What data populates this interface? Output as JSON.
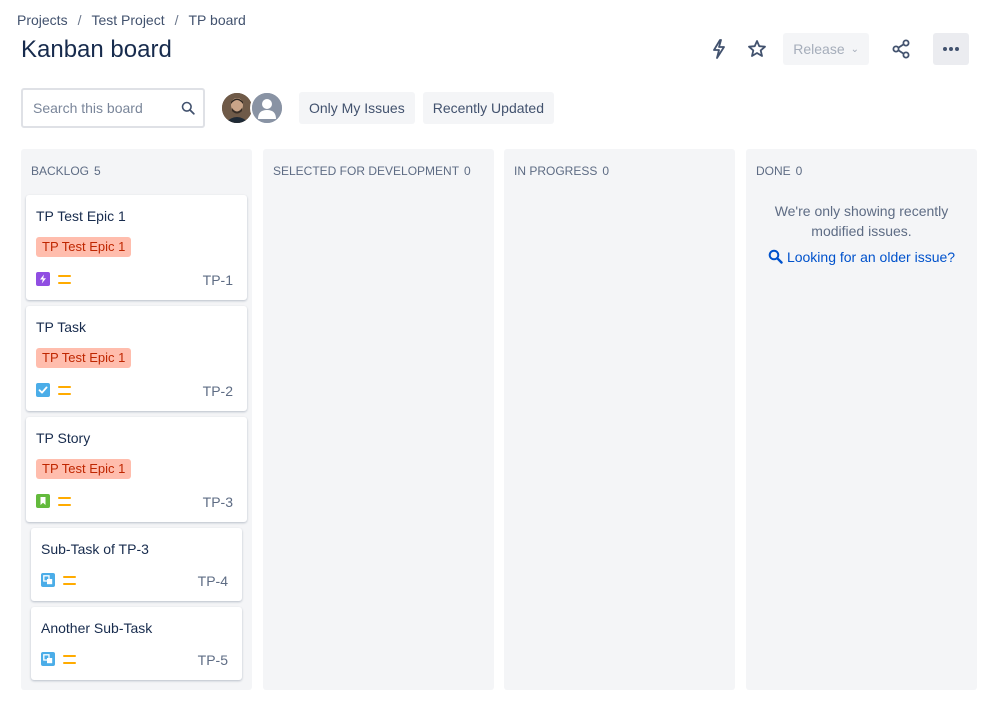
{
  "breadcrumb": [
    "Projects",
    "Test Project",
    "TP board"
  ],
  "breadcrumb_sep": "/",
  "title": "Kanban board",
  "header": {
    "actions": [
      "lightning-icon",
      "star-icon",
      "release",
      "share-icon",
      "more-icon"
    ],
    "release_label": "Release"
  },
  "search": {
    "placeholder": "Search this board"
  },
  "filters": {
    "only_my_issues": "Only My Issues",
    "recently_updated": "Recently Updated"
  },
  "columns": [
    {
      "name": "BACKLOG",
      "count": "5"
    },
    {
      "name": "SELECTED FOR DEVELOPMENT",
      "count": "0"
    },
    {
      "name": "IN PROGRESS",
      "count": "0"
    },
    {
      "name": "DONE",
      "count": "0"
    }
  ],
  "cards": [
    {
      "summary": "TP Test Epic 1",
      "epic": "TP Test Epic 1",
      "type": "epic",
      "priority": "medium",
      "key": "TP-1"
    },
    {
      "summary": "TP Task",
      "epic": "TP Test Epic 1",
      "type": "task",
      "priority": "medium",
      "key": "TP-2"
    },
    {
      "summary": "TP Story",
      "epic": "TP Test Epic 1",
      "type": "story",
      "priority": "medium",
      "key": "TP-3"
    },
    {
      "summary": "Sub-Task of TP-3",
      "type": "subtask",
      "priority": "medium",
      "key": "TP-4"
    },
    {
      "summary": "Another Sub-Task",
      "type": "subtask",
      "priority": "medium",
      "key": "TP-5"
    }
  ],
  "done_column": {
    "message": "We're only showing recently modified issues.",
    "older_link": "Looking for an older issue?"
  },
  "colors": {
    "epic_type": "#904ee2",
    "task_type": "#4bade8",
    "story_type": "#63ba3c",
    "priority_medium": "#ffab00",
    "epic_tag_bg": "#ffbdad",
    "epic_tag_text": "#bf2600",
    "link": "#0052cc",
    "column_bg": "#f4f5f7"
  }
}
